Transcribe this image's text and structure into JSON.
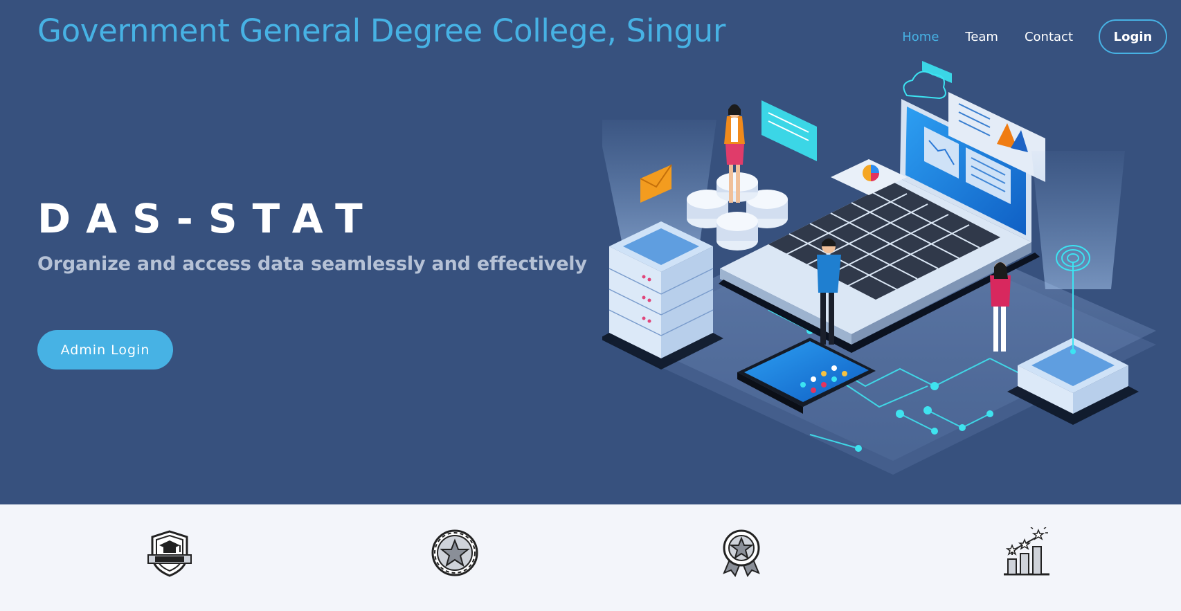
{
  "header": {
    "brand": "Government General Degree College, Singur",
    "nav": [
      {
        "label": "Home",
        "active": true
      },
      {
        "label": "Team",
        "active": false
      },
      {
        "label": "Contact",
        "active": false
      }
    ],
    "login_label": "Login"
  },
  "hero": {
    "title": "DAS-STAT",
    "subtitle": "Organize and access data seamlessly and effectively",
    "cta_label": "Admin Login"
  },
  "features": {
    "icons": [
      "college-badge-icon",
      "star-coin-icon",
      "award-ribbon-icon",
      "growth-chart-icon"
    ]
  },
  "colors": {
    "hero_bg": "#37517e",
    "accent": "#47b2e4",
    "subtitle": "#b6c2d6",
    "features_bg": "#f3f5fa"
  }
}
